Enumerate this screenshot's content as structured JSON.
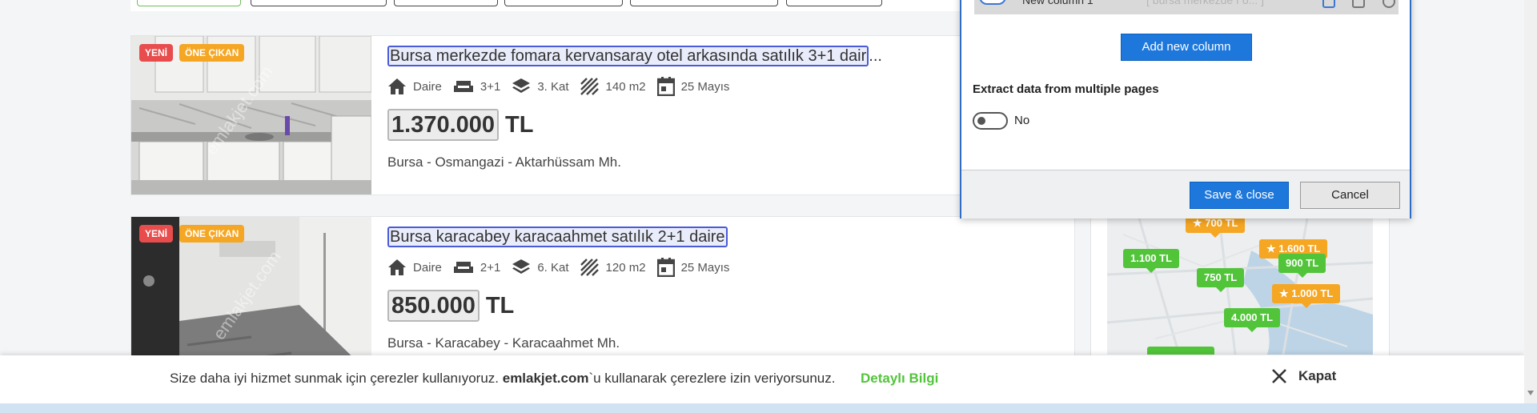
{
  "listings": [
    {
      "badge_new": "YENİ",
      "badge_featured": "ÖNE ÇIKAN",
      "watermark": "emlakjet.com",
      "title_highlight": "Bursa merkezde fomara kervansaray otel arkasında satılık 3+1 dair",
      "title_rest": "...",
      "type": "Daire",
      "rooms": "3+1",
      "floor": "3. Kat",
      "area": "140 m2",
      "date": "25 Mayıs",
      "price": "1.370.000",
      "currency": "TL",
      "location": "Bursa - Osmangazi - Aktarhüssam Mh."
    },
    {
      "badge_new": "YENİ",
      "badge_featured": "ÖNE ÇIKAN",
      "watermark": "emlakjet.com",
      "title_highlight": "Bursa karacabey karacaahmet satılık 2+1 daire",
      "title_rest": "",
      "type": "Daire",
      "rooms": "2+1",
      "floor": "6. Kat",
      "area": "120 m2",
      "date": "25 Mayıs",
      "price": "850.000",
      "currency": "TL",
      "location": "Bursa - Karacabey - Karacaahmet Mh."
    }
  ],
  "map": {
    "pins": [
      {
        "label": "700 TL",
        "color": "orange",
        "star": true
      },
      {
        "label": "1.600 TL",
        "color": "orange",
        "star": true
      },
      {
        "label": "1.100 TL",
        "color": "green",
        "star": false
      },
      {
        "label": "900 TL",
        "color": "green",
        "star": false
      },
      {
        "label": "750 TL",
        "color": "green",
        "star": false
      },
      {
        "label": "1.000 TL",
        "color": "orange",
        "star": true
      },
      {
        "label": "4.000 TL",
        "color": "green",
        "star": false
      }
    ]
  },
  "dialog": {
    "column_row_name": "New column 1",
    "column_row_preview": "[ bursa merkezde f o...    ]",
    "add_column_label": "Add new column",
    "extract_label": "Extract data from multiple pages",
    "toggle_value": "No",
    "save_label": "Save & close",
    "cancel_label": "Cancel"
  },
  "cookie": {
    "text_before": "Size daha iyi hizmet sunmak için çerezler kullanıyoruz. ",
    "site": "emlakjet.com",
    "text_after": "`u kullanarak çerezlere izin veriyorsunuz.",
    "link_label": "Detaylı Bilgi",
    "close_label": "Kapat"
  },
  "colors": {
    "accent_blue": "#1e78dc",
    "green": "#52c43a",
    "orange": "#f5a623",
    "badge_red": "#e84c4c"
  }
}
